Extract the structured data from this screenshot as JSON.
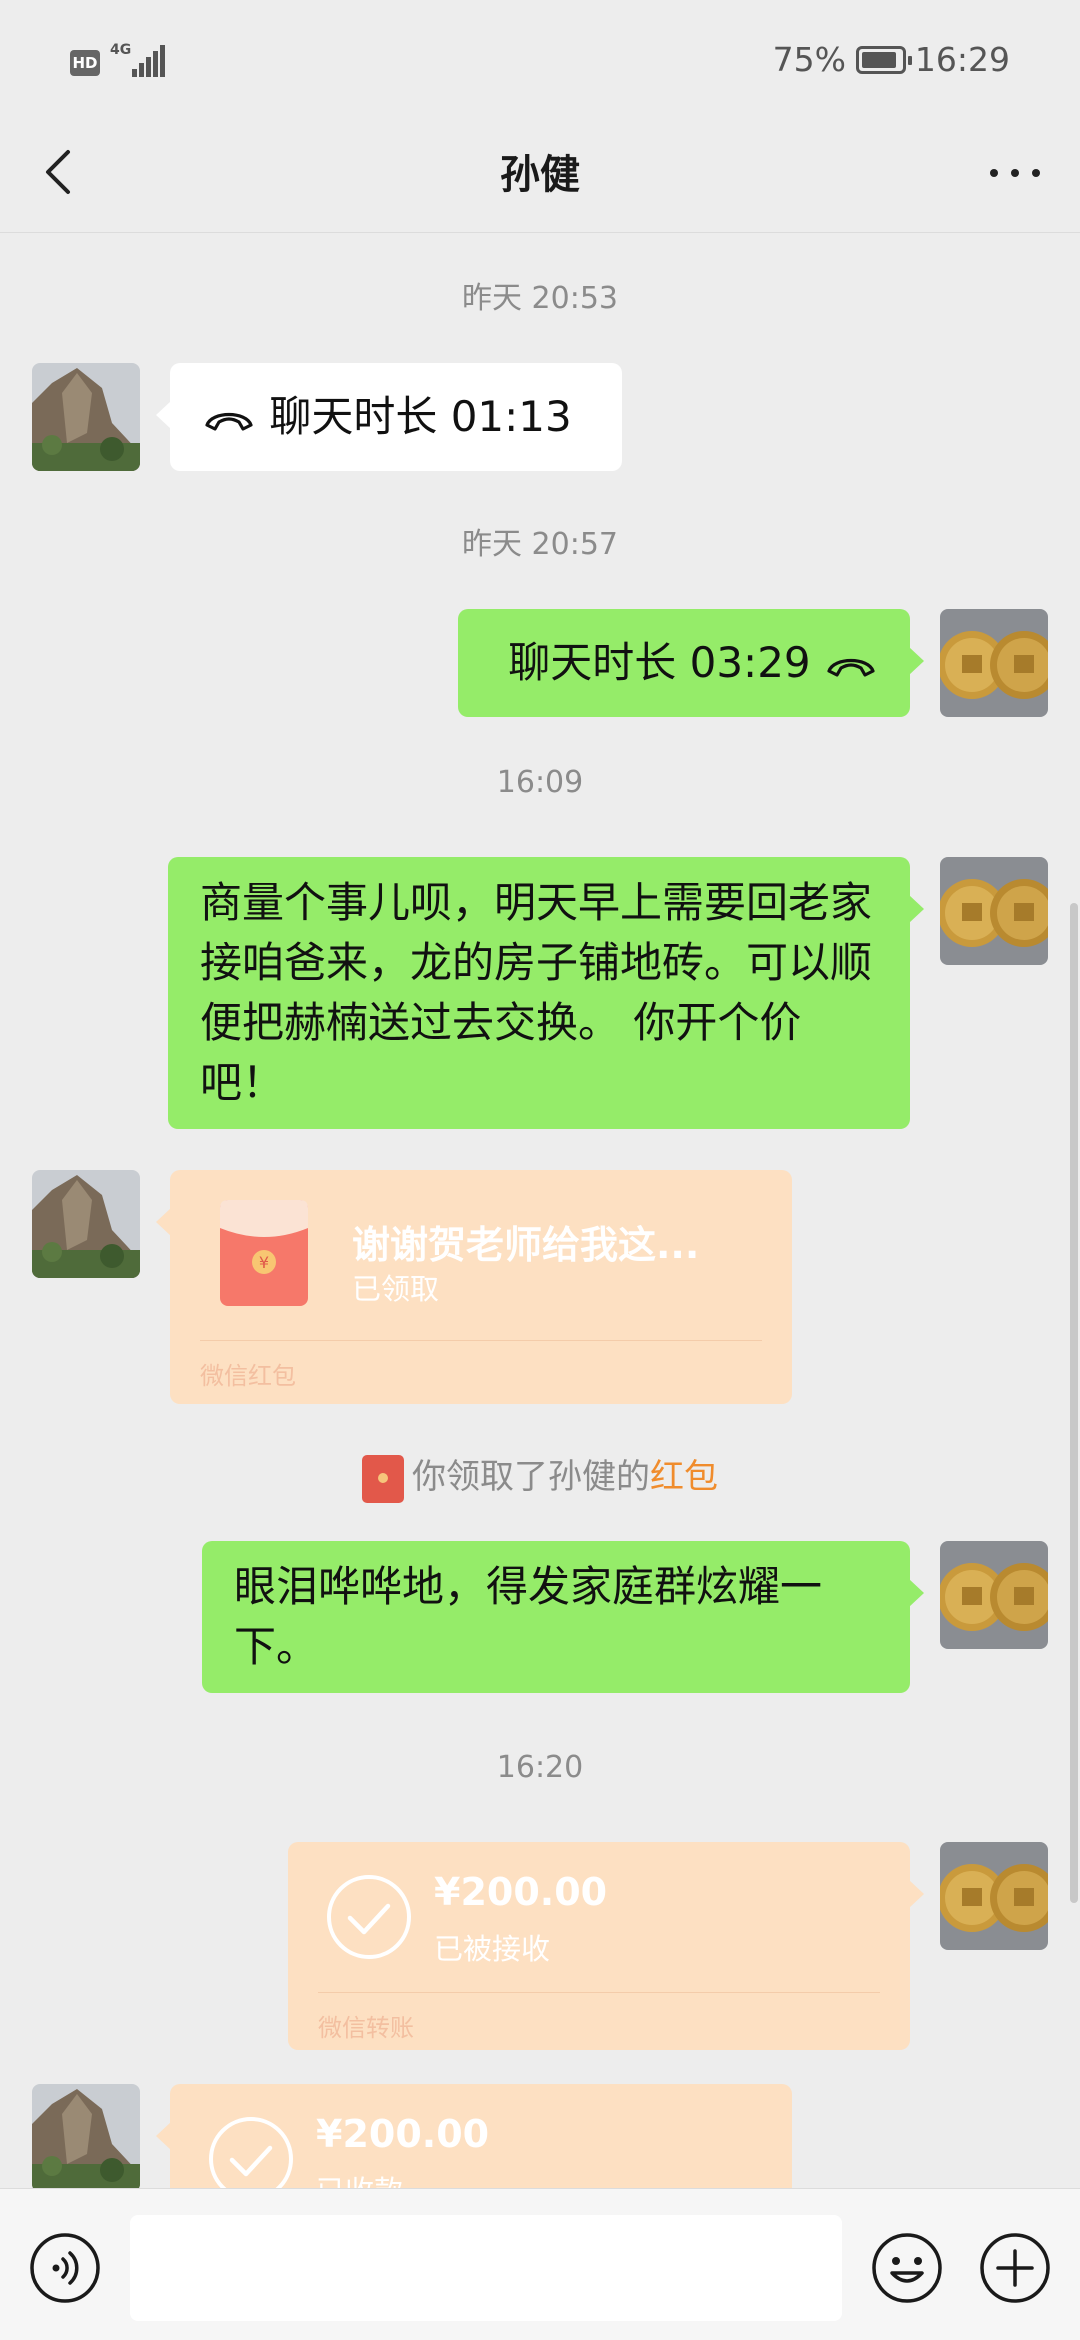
{
  "status_bar": {
    "hd": "HD",
    "network": "4G",
    "battery": "75%",
    "time": "16:29"
  },
  "header": {
    "title": "孙健"
  },
  "messages": {
    "ts1": "昨天 20:53",
    "call_in": "聊天时长 01:13",
    "ts2": "昨天 20:57",
    "call_out": "聊天时长 03:29",
    "ts3": "16:09",
    "text1": "商量个事儿呗，明天早上需要回老家接咱爸来，龙的房子铺地砖。可以顺便把赫楠送过去交换。 你开个价吧！",
    "packet": {
      "title": "谢谢贺老师给我这...",
      "status": "已领取",
      "footer": "微信红包",
      "symbol": "¥"
    },
    "system": {
      "prefix": "你领取了孙健的",
      "highlight": "红包"
    },
    "text2": "眼泪哗哗地，得发家庭群炫耀一下。",
    "ts4": "16:20",
    "transfer_out": {
      "amount": "¥200.00",
      "status": "已被接收",
      "footer": "微信转账"
    },
    "transfer_in": {
      "amount": "¥200.00",
      "status": "已收款"
    }
  },
  "input": {
    "placeholder": ""
  },
  "colors": {
    "background": "#ededed",
    "sent_bubble": "#95ec69",
    "received_bubble": "#ffffff",
    "payment_card": "#fde0c2",
    "highlight": "#f08c2c"
  }
}
